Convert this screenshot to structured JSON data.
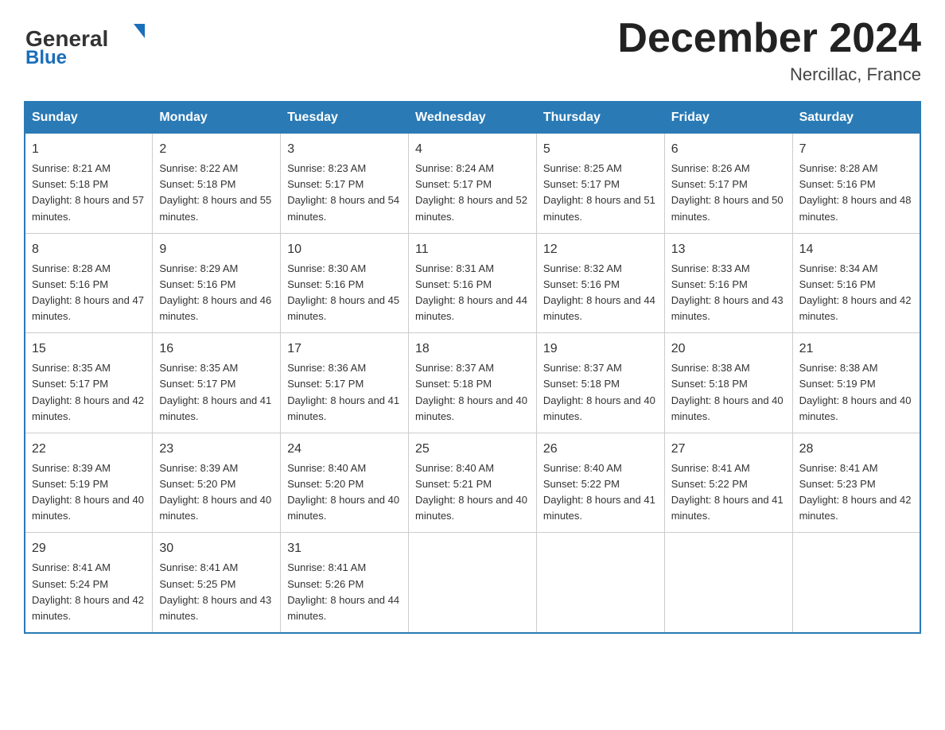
{
  "header": {
    "logo_general": "General",
    "logo_blue": "Blue",
    "month_title": "December 2024",
    "location": "Nercillac, France"
  },
  "days_of_week": [
    "Sunday",
    "Monday",
    "Tuesday",
    "Wednesday",
    "Thursday",
    "Friday",
    "Saturday"
  ],
  "weeks": [
    [
      {
        "num": "1",
        "sunrise": "8:21 AM",
        "sunset": "5:18 PM",
        "daylight": "8 hours and 57 minutes."
      },
      {
        "num": "2",
        "sunrise": "8:22 AM",
        "sunset": "5:18 PM",
        "daylight": "8 hours and 55 minutes."
      },
      {
        "num": "3",
        "sunrise": "8:23 AM",
        "sunset": "5:17 PM",
        "daylight": "8 hours and 54 minutes."
      },
      {
        "num": "4",
        "sunrise": "8:24 AM",
        "sunset": "5:17 PM",
        "daylight": "8 hours and 52 minutes."
      },
      {
        "num": "5",
        "sunrise": "8:25 AM",
        "sunset": "5:17 PM",
        "daylight": "8 hours and 51 minutes."
      },
      {
        "num": "6",
        "sunrise": "8:26 AM",
        "sunset": "5:17 PM",
        "daylight": "8 hours and 50 minutes."
      },
      {
        "num": "7",
        "sunrise": "8:28 AM",
        "sunset": "5:16 PM",
        "daylight": "8 hours and 48 minutes."
      }
    ],
    [
      {
        "num": "8",
        "sunrise": "8:28 AM",
        "sunset": "5:16 PM",
        "daylight": "8 hours and 47 minutes."
      },
      {
        "num": "9",
        "sunrise": "8:29 AM",
        "sunset": "5:16 PM",
        "daylight": "8 hours and 46 minutes."
      },
      {
        "num": "10",
        "sunrise": "8:30 AM",
        "sunset": "5:16 PM",
        "daylight": "8 hours and 45 minutes."
      },
      {
        "num": "11",
        "sunrise": "8:31 AM",
        "sunset": "5:16 PM",
        "daylight": "8 hours and 44 minutes."
      },
      {
        "num": "12",
        "sunrise": "8:32 AM",
        "sunset": "5:16 PM",
        "daylight": "8 hours and 44 minutes."
      },
      {
        "num": "13",
        "sunrise": "8:33 AM",
        "sunset": "5:16 PM",
        "daylight": "8 hours and 43 minutes."
      },
      {
        "num": "14",
        "sunrise": "8:34 AM",
        "sunset": "5:16 PM",
        "daylight": "8 hours and 42 minutes."
      }
    ],
    [
      {
        "num": "15",
        "sunrise": "8:35 AM",
        "sunset": "5:17 PM",
        "daylight": "8 hours and 42 minutes."
      },
      {
        "num": "16",
        "sunrise": "8:35 AM",
        "sunset": "5:17 PM",
        "daylight": "8 hours and 41 minutes."
      },
      {
        "num": "17",
        "sunrise": "8:36 AM",
        "sunset": "5:17 PM",
        "daylight": "8 hours and 41 minutes."
      },
      {
        "num": "18",
        "sunrise": "8:37 AM",
        "sunset": "5:18 PM",
        "daylight": "8 hours and 40 minutes."
      },
      {
        "num": "19",
        "sunrise": "8:37 AM",
        "sunset": "5:18 PM",
        "daylight": "8 hours and 40 minutes."
      },
      {
        "num": "20",
        "sunrise": "8:38 AM",
        "sunset": "5:18 PM",
        "daylight": "8 hours and 40 minutes."
      },
      {
        "num": "21",
        "sunrise": "8:38 AM",
        "sunset": "5:19 PM",
        "daylight": "8 hours and 40 minutes."
      }
    ],
    [
      {
        "num": "22",
        "sunrise": "8:39 AM",
        "sunset": "5:19 PM",
        "daylight": "8 hours and 40 minutes."
      },
      {
        "num": "23",
        "sunrise": "8:39 AM",
        "sunset": "5:20 PM",
        "daylight": "8 hours and 40 minutes."
      },
      {
        "num": "24",
        "sunrise": "8:40 AM",
        "sunset": "5:20 PM",
        "daylight": "8 hours and 40 minutes."
      },
      {
        "num": "25",
        "sunrise": "8:40 AM",
        "sunset": "5:21 PM",
        "daylight": "8 hours and 40 minutes."
      },
      {
        "num": "26",
        "sunrise": "8:40 AM",
        "sunset": "5:22 PM",
        "daylight": "8 hours and 41 minutes."
      },
      {
        "num": "27",
        "sunrise": "8:41 AM",
        "sunset": "5:22 PM",
        "daylight": "8 hours and 41 minutes."
      },
      {
        "num": "28",
        "sunrise": "8:41 AM",
        "sunset": "5:23 PM",
        "daylight": "8 hours and 42 minutes."
      }
    ],
    [
      {
        "num": "29",
        "sunrise": "8:41 AM",
        "sunset": "5:24 PM",
        "daylight": "8 hours and 42 minutes."
      },
      {
        "num": "30",
        "sunrise": "8:41 AM",
        "sunset": "5:25 PM",
        "daylight": "8 hours and 43 minutes."
      },
      {
        "num": "31",
        "sunrise": "8:41 AM",
        "sunset": "5:26 PM",
        "daylight": "8 hours and 44 minutes."
      },
      null,
      null,
      null,
      null
    ]
  ]
}
